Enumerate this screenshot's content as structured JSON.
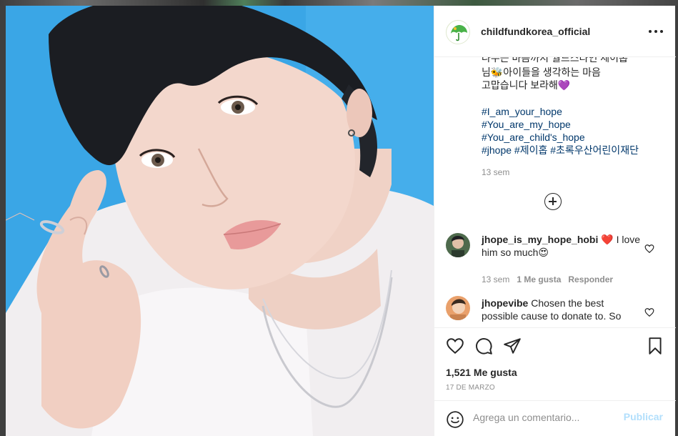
{
  "post": {
    "username": "childfundkorea_official",
    "caption_lines": [
      "나누는 마음까지 월드스타인 제이홉",
      "님🐝아이들을 생각하는 마음",
      "고맙습니다 보라해💜"
    ],
    "hashtags": [
      "#I_am_your_hope",
      "#You_are_my_hope",
      "#You_are_child's_hope",
      "#jhope #제이홉 #초록우산어린이재단"
    ],
    "caption_time": "13 sem",
    "likes": "1,521 Me gusta",
    "date": "17 DE MARZO"
  },
  "comments": [
    {
      "username": "jhope_is_my_hope_hobi",
      "text_line1": " ❤️ I love",
      "text_line2": "him so much😍",
      "time": "13 sem",
      "likes": "1 Me gusta",
      "reply": "Responder"
    },
    {
      "username": "jhopevibe",
      "text_line1": " Chosen the best",
      "text_line2": "possible cause to donate to. So"
    }
  ],
  "compose": {
    "placeholder": "Agrega un comentario...",
    "publish": "Publicar"
  },
  "icons": {
    "more": "more-options-icon",
    "load_more": "add-circle-icon",
    "like": "heart-icon",
    "comment": "comment-icon",
    "share": "paper-plane-icon",
    "save": "bookmark-icon",
    "emoji": "smiley-icon"
  },
  "colors": {
    "link": "#00376b",
    "muted": "#8e8e8e",
    "publish_disabled": "#b2dffc",
    "background_blue": "#3da6e6"
  }
}
